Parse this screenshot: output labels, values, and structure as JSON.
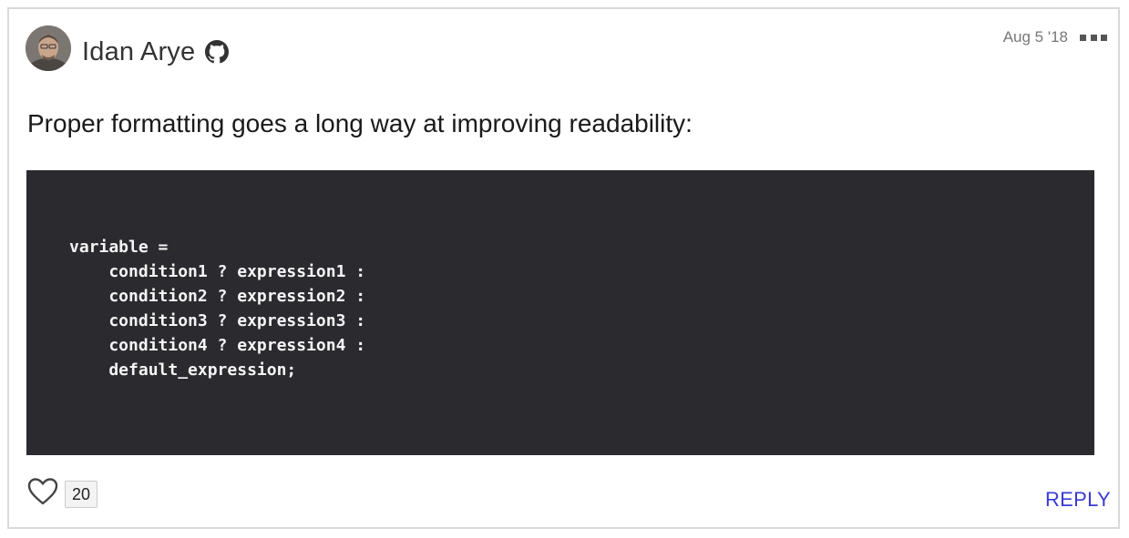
{
  "comment": {
    "author": "Idan Arye",
    "date": "Aug 5 '18",
    "text": "Proper formatting goes a long way at improving readability:",
    "code": "variable =\n    condition1 ? expression1 :\n    condition2 ? expression2 :\n    condition3 ? expression3 :\n    condition4 ? expression4 :\n    default_expression;",
    "like_count": "20",
    "reply_label": "REPLY"
  },
  "icons": {
    "author_badge": "github-icon",
    "menu": "more-options-icon",
    "like": "heart-icon"
  },
  "colors": {
    "code_background": "#2a2a2f",
    "reply_link": "#3a3ad6",
    "card_border": "#d9d9d9"
  }
}
